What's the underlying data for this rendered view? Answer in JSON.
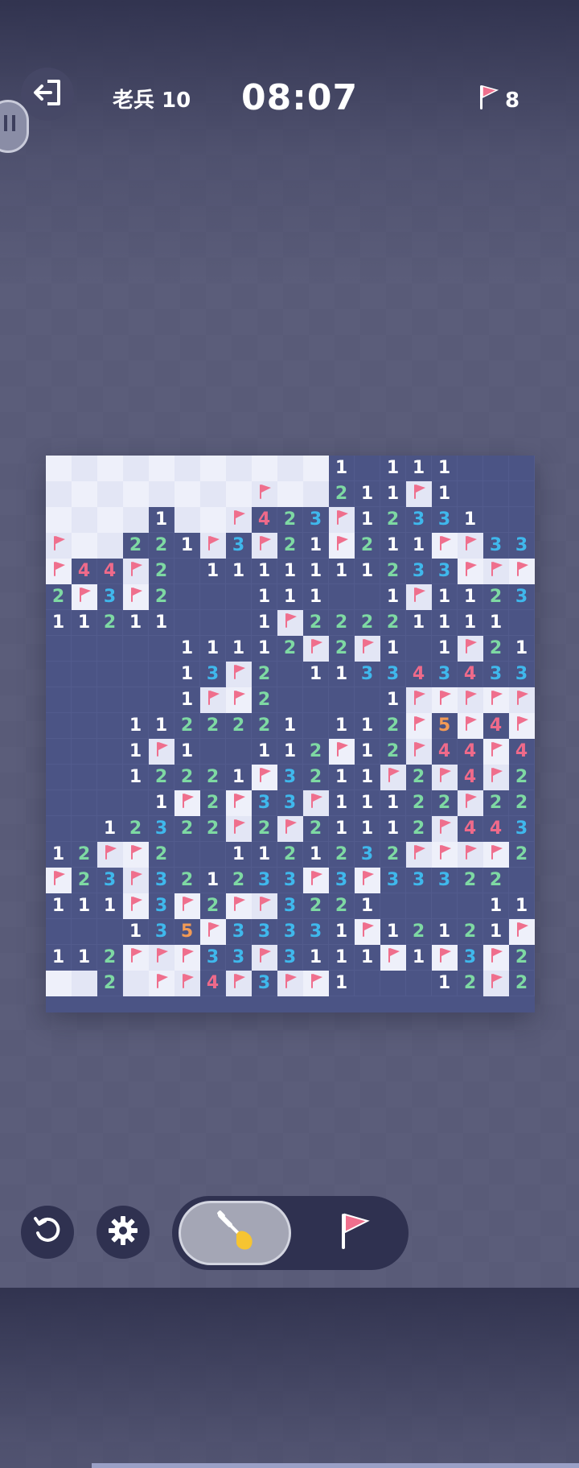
{
  "header": {
    "level_label": "老兵 10",
    "timer": "08:07",
    "flag_count": "8"
  },
  "icons": {
    "exit": "exit-door-icon",
    "flag": "flag-icon",
    "restart": "restart-icon",
    "settings": "gear-icon",
    "shovel": "shovel-icon"
  },
  "colors": {
    "flag_pink": "#ef6f8d",
    "num1": "#ffffff",
    "num2": "#7ed9a3",
    "num3": "#3fb8ec",
    "num4": "#ef6a8a",
    "num5": "#f29a55"
  },
  "board": {
    "cols": 19,
    "legend": "C=covered, F=flag, .=open empty, digit=count",
    "rows": [
      "CCCCCCCCCCC1.111...",
      "CCCCCCCCFCC211F1...",
      "CCCC1CCF423F12331..",
      "FCC221F3F21F211FF332",
      "F44F2.1111111233FFF",
      "2F3F2...111..1F1123",
      "11211...1F22221111.",
      ".....11112F2F1.1F21",
      ".....13F2.113343433F",
      ".....1FF2....1FFFFF43",
      "...1122221.112F5F4FF",
      "...1F1..112F12F44F42",
      "...12221F3211F2F4F2.",
      "....1F2F33F11122F221",
      "..12322F2F21112F44332F",
      "12FF2..1121232FFFF2F2",
      "F23F321233F3F33322.11",
      "111F3F2FF3221....11",
      "...135F33331F12121F",
      "112FFF33F3111F1F3F21",
      "CC2CFF4F3FF1...12F21."
    ]
  }
}
